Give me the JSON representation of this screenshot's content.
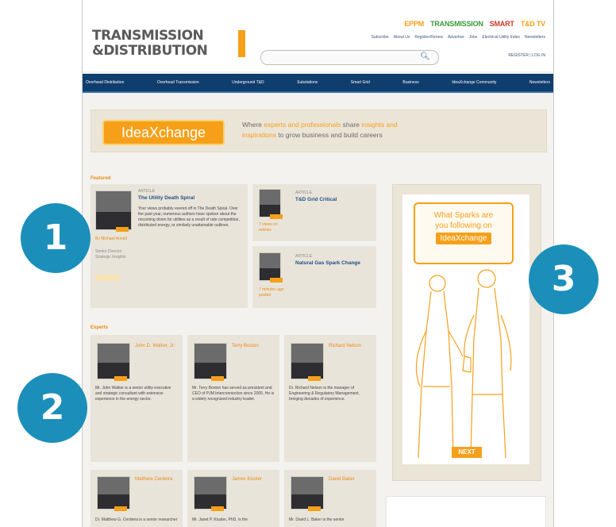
{
  "header": {
    "logo_line1": "TRANSMISSION",
    "logo_line2": "&DISTRIBUTION",
    "brands": [
      {
        "label": "EPPM",
        "color": "#f6a01a"
      },
      {
        "label": "TRANSMISSION",
        "color": "#3a9a3a"
      },
      {
        "label": "SMART",
        "color": "#d0372a"
      },
      {
        "label": "T&D TV",
        "color": "#f6a01a"
      }
    ],
    "top_links": [
      "Subscribe",
      "About Us",
      "Register/Renew",
      "Advertise",
      "Jobs",
      "Electrical Utility Index",
      "Newsletters"
    ],
    "auth": "REGISTER | LOG IN"
  },
  "nav": {
    "items": [
      "Overhead Distribution",
      "Overhead Transmission",
      "Underground T&D",
      "Substations",
      "Smart Grid",
      "Business",
      "IdeaXchange Community",
      "Newsletters"
    ]
  },
  "banner": {
    "logo": "IdeaXchange",
    "line1_a": "Where ",
    "line1_hl": "experts and professionals",
    "line1_b": " share ",
    "line1_hl2": "insights and",
    "line2_hl": "inspirations",
    "line2_b": " to grow business and build careers"
  },
  "featured": {
    "heading": "Featured",
    "main": {
      "kicker": "ARTICLE",
      "title": "The Utility Death Spiral",
      "desc": "Your views probably veered off in The Death Spiral. Over the past year, numerous authors have spoken about the oncoming doom for utilities as a result of rate competition, distributed energy, or similarly unattainable outlines.",
      "byline": "By Michael Arnold",
      "sub": "Senior Director Strategic Insights"
    },
    "side": [
      {
        "kicker": "ARTICLE",
        "title": "T&D Grid Critical",
        "meta": "7 views on articles"
      },
      {
        "kicker": "ARTICLE",
        "title": "Natural Gas Spark Change",
        "meta": "7 minutes ago posted"
      }
    ]
  },
  "experts": {
    "heading": "Experts",
    "row1": [
      {
        "name": "John D. Walker, Jr.",
        "desc": "Mr. John Walker is a senior utility executive and strategic consultant with extensive experience in the energy sector."
      },
      {
        "name": "Terry Boston",
        "desc": "Mr. Terry Boston has served as president and CEO of PJM Interconnection since 2005. He is a widely recognized industry leader."
      },
      {
        "name": "Richard Nelson",
        "desc": "Dr. Richard Nelson is the manager of Engineering & Regulatory Management, bringing decades of experience."
      }
    ],
    "row2": [
      {
        "name": "Matthew Cerdeira",
        "desc": "Dr. Matthew G. Cerdeira is a senior researcher"
      },
      {
        "name": "James Kluster",
        "desc": "Mr. Janet P. Kluster, PhD, is the"
      },
      {
        "name": "David Baker",
        "desc": "Mr. David L. Baker is the senior"
      }
    ]
  },
  "ad": {
    "question_a": "What Sparks are",
    "question_b": "you following on",
    "pill": "IdeaXchange",
    "next": "NEXT"
  },
  "callouts": [
    "1",
    "2",
    "3"
  ],
  "colors": {
    "accent": "#f6a01a",
    "nav": "#0f3d6e",
    "badge": "#1b8fba"
  }
}
